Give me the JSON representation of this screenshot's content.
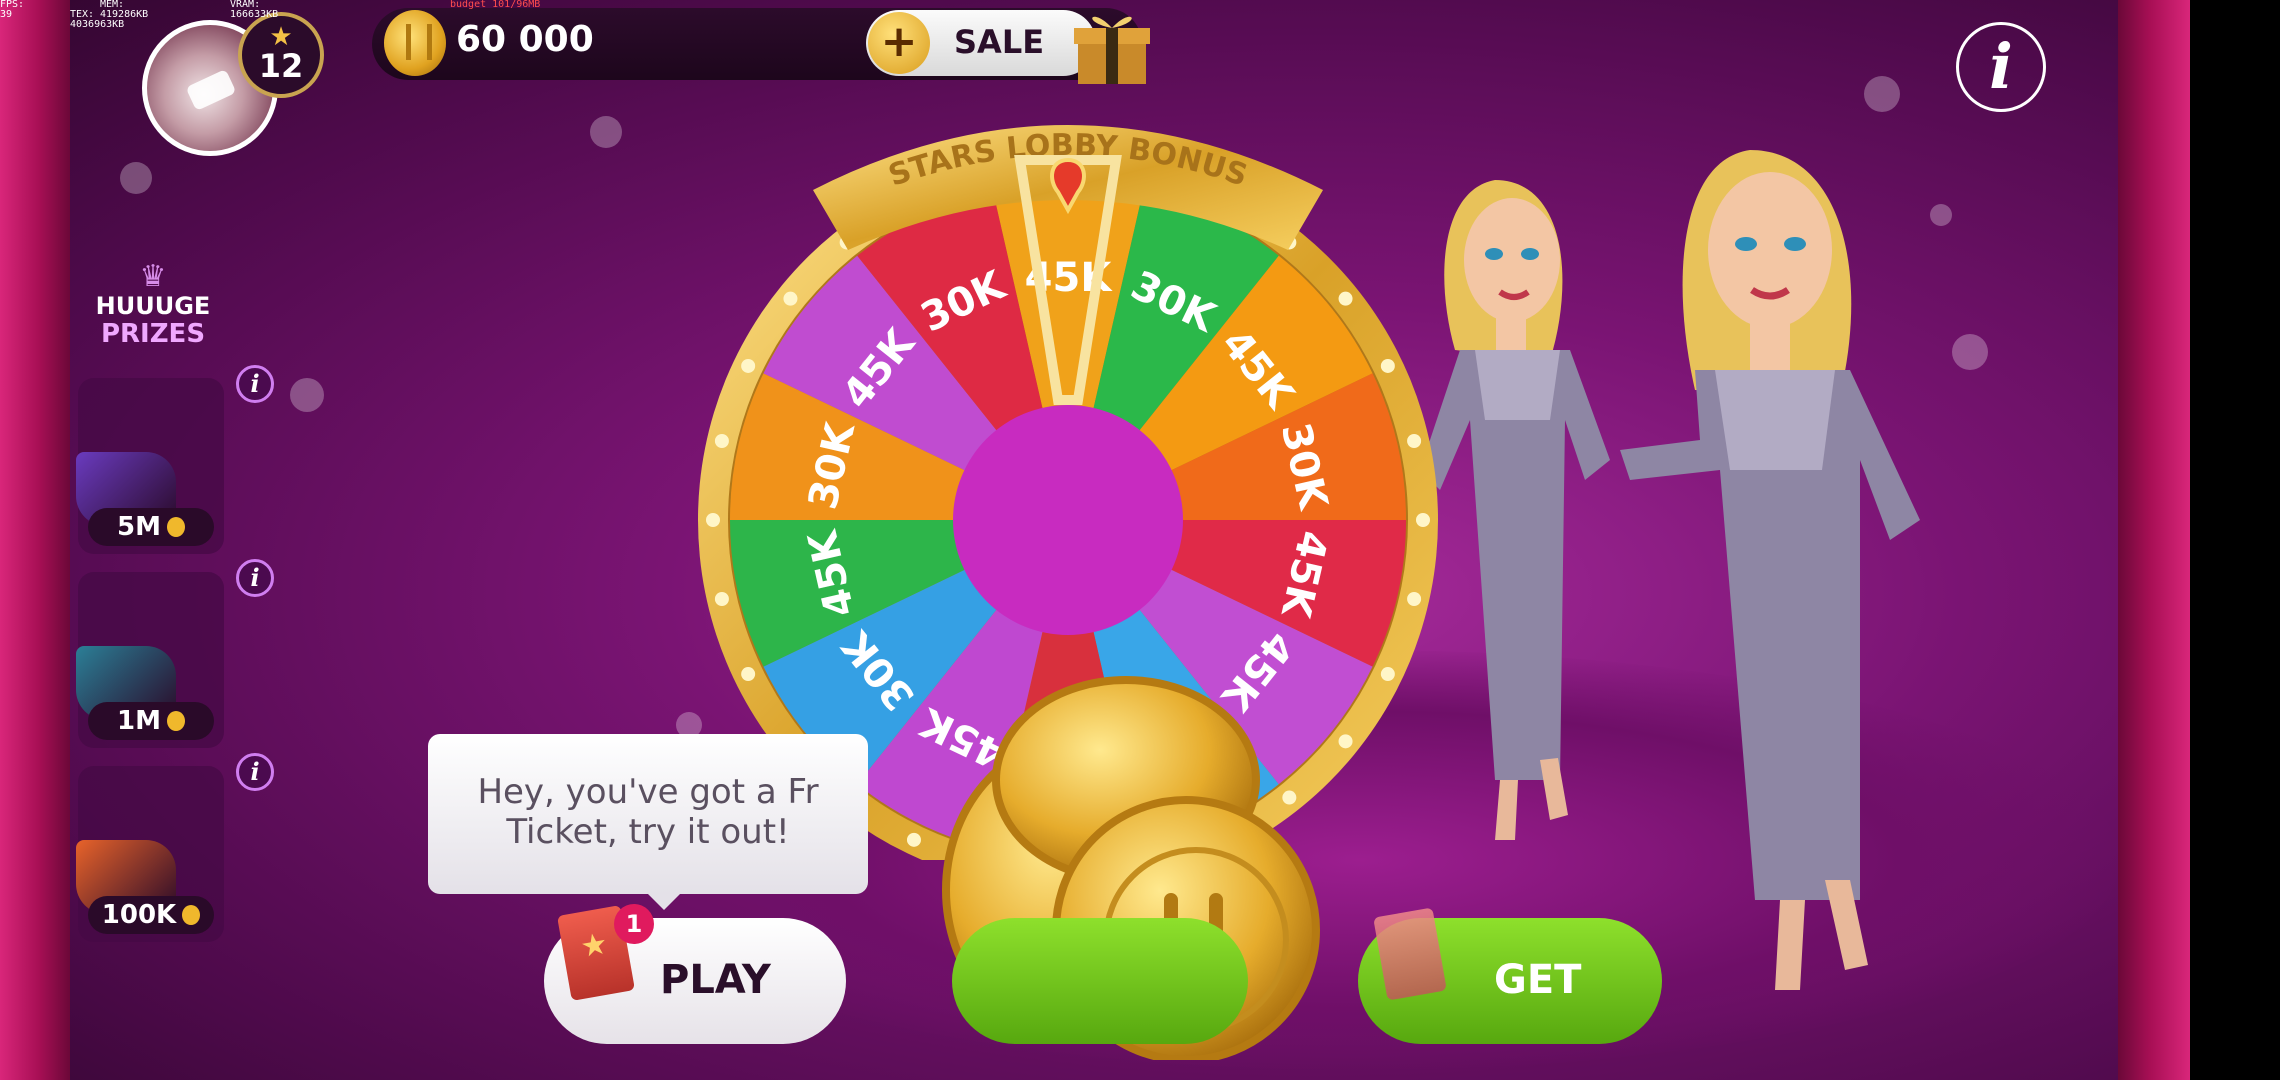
{
  "debug": {
    "fps": "FPS: 39",
    "mem": "MEM: 419286KB",
    "tex": "TEX: 4036963KB",
    "vram": "VRAM: 166633KB",
    "budget": "budget 101/96MB"
  },
  "player": {
    "level": "12"
  },
  "balance": {
    "coins": "60 000"
  },
  "sale_button": {
    "plus": "+",
    "label": "SALE"
  },
  "info_button": {
    "glyph": "i"
  },
  "prizes": {
    "crown": "♛",
    "title_line1": "HUUUGE",
    "title_line2": "PRIZES",
    "items": [
      {
        "value": "5M",
        "info": "i",
        "color": "#6a3bbf"
      },
      {
        "value": "1M",
        "info": "i",
        "color": "#2b7f97"
      },
      {
        "value": "100K",
        "info": "i",
        "color": "#e8632a"
      }
    ]
  },
  "wheel": {
    "banner": "STARS LOBBY BONUS",
    "segments": [
      {
        "label": "45K",
        "color": "#f0a21a"
      },
      {
        "label": "30K",
        "color": "#2bb84a"
      },
      {
        "label": "45K",
        "color": "#f49a12"
      },
      {
        "label": "30K",
        "color": "#f06a1a"
      },
      {
        "label": "45K",
        "color": "#e02a48"
      },
      {
        "label": "45K",
        "color": "#c14ed2"
      },
      {
        "label": "30K",
        "color": "#39a6e8"
      },
      {
        "label": "45K",
        "color": "#d8303d"
      },
      {
        "label": "45K",
        "color": "#bf48d0"
      },
      {
        "label": "30K",
        "color": "#35a0e4"
      },
      {
        "label": "45K",
        "color": "#2db54a"
      },
      {
        "label": "30K",
        "color": "#f0921a"
      },
      {
        "label": "45K",
        "color": "#c04cd0"
      },
      {
        "label": "30K",
        "color": "#de2a44"
      }
    ],
    "hub_color": "#c82bc0"
  },
  "bubble": {
    "text": "Hey, you've got a Fr\nTicket, try it out!"
  },
  "play_button": {
    "label": "PLAY",
    "badge": "1",
    "star": "★"
  },
  "get_button": {
    "label": "GET"
  }
}
